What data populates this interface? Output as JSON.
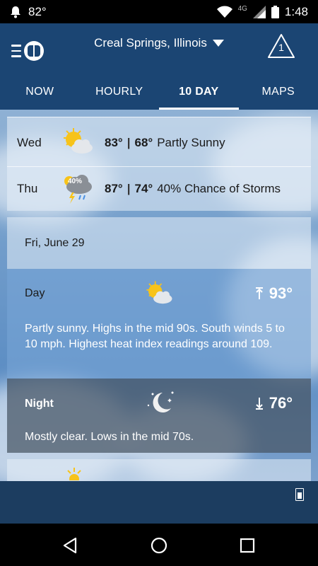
{
  "status_bar": {
    "temperature": "82°",
    "network": "4G",
    "time": "1:48"
  },
  "header": {
    "location": "Creal Springs, Illinois",
    "alert_count": "1"
  },
  "tabs": [
    {
      "label": "NOW"
    },
    {
      "label": "HOURLY"
    },
    {
      "label": "10 DAY"
    },
    {
      "label": "MAPS"
    }
  ],
  "forecast_rows": [
    {
      "day": "Wed",
      "icon": "partly-sunny-icon",
      "high": "83°",
      "low": "68°",
      "condition": "Partly Sunny"
    },
    {
      "day": "Thu",
      "icon": "storm-icon",
      "precip": "40%",
      "high": "87°",
      "low": "74°",
      "condition": "40% Chance of Storms"
    }
  ],
  "detail": {
    "date": "Fri, June 29",
    "day": {
      "label": "Day",
      "icon": "partly-sunny-icon",
      "temp": "93°",
      "text": "Partly sunny. Highs in the mid 90s. South winds 5 to 10 mph. Highest heat index readings around 109."
    },
    "night": {
      "label": "Night",
      "icon": "moon-clear-icon",
      "temp": "76°",
      "text": "Mostly clear. Lows in the mid 70s."
    }
  },
  "colors": {
    "header_bg": "#1b4573",
    "sun": "#f7c31a",
    "cloud": "#dfe3e8"
  }
}
